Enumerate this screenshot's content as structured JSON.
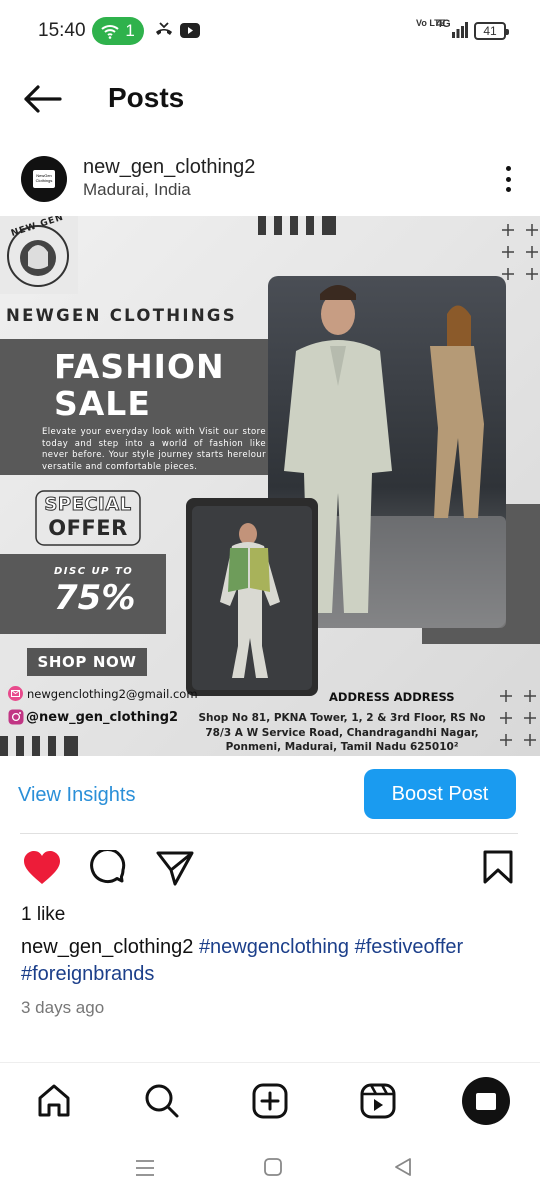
{
  "status_bar": {
    "time": "15:40",
    "hotspot_count": "1",
    "volte": "Vo LTE",
    "network": "4G",
    "battery": "41"
  },
  "header": {
    "title": "Posts"
  },
  "post": {
    "username": "new_gen_clothing2",
    "location": "Madurai, India",
    "avatar_text": "NewGen Clothings",
    "image": {
      "brand_logo_text": "NEW GEN",
      "brand_name": "NEWGEN CLOTHINGS",
      "headline": "FASHION SALE",
      "headline_line1": "FASHION",
      "headline_line2": "SALE",
      "body_text": "Elevate your everyday look with Visit our store today and step into a world of fashion like never before. Your style journey starts herelour versatile and comfortable pieces.",
      "special_line1": "SPECIAL",
      "special_line2": "OFFER",
      "disc_label": "DISC UP TO",
      "disc_value": "75%",
      "shop_now": "SHOP NOW",
      "email": "newgenclothing2@gmail.com",
      "instagram": "@new_gen_clothing2",
      "address_title": "ADDRESS ADDRESS",
      "address_text": "Shop No 81, PKNA Tower, 1, 2 & 3rd Floor, RS No 78/3 A W Service Road, Chandragandhi Nagar, Ponmeni, Madurai, Tamil Nadu 625010²"
    },
    "insights_label": "View Insights",
    "boost_label": "Boost Post",
    "likes": "1 like",
    "caption_user": "new_gen_clothing2",
    "caption_tags": [
      "#newgenclothing",
      "#festiveoffer",
      "#foreignbrands"
    ],
    "time_ago": "3 days ago"
  },
  "colors": {
    "accent": "#1a9bf0",
    "link": "#2a8fd8",
    "heart": "#ed1c39",
    "hotspot": "#2fb24c"
  }
}
